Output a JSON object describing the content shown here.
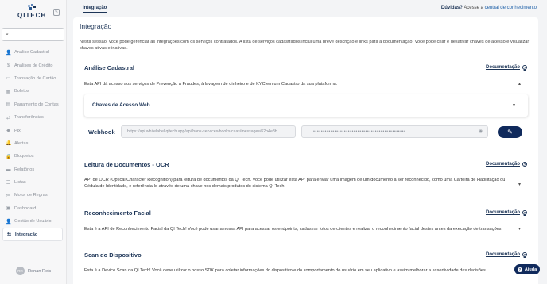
{
  "app": {
    "logo_text": "QITECH",
    "collapse_icon": "<"
  },
  "search": {
    "placeholder": ""
  },
  "sidebar": {
    "items": [
      {
        "label": "Análise Cadastral",
        "icon": "person-icon",
        "glyph": "👤"
      },
      {
        "label": "Análises de Crédito",
        "icon": "dollar-icon",
        "glyph": "$"
      },
      {
        "label": "Transação de Cartão",
        "icon": "card-icon",
        "glyph": "▭"
      },
      {
        "label": "Boletos",
        "icon": "barcode-icon",
        "glyph": "▦"
      },
      {
        "label": "Pagamento de Contas",
        "icon": "receipt-icon",
        "glyph": "▤"
      },
      {
        "label": "Transferências",
        "icon": "transfer-icon",
        "glyph": "⇄"
      },
      {
        "label": "Pix",
        "icon": "pix-icon",
        "glyph": "◆"
      },
      {
        "label": "Alertas",
        "icon": "bell-icon",
        "glyph": "🔔"
      },
      {
        "label": "Bloqueios",
        "icon": "lock-icon",
        "glyph": "🔒"
      },
      {
        "label": "Relatórios",
        "icon": "file-icon",
        "glyph": "▬"
      },
      {
        "label": "Listas",
        "icon": "list-icon",
        "glyph": "☰"
      },
      {
        "label": "Motor de Regras",
        "icon": "rules-icon",
        "glyph": "≔"
      },
      {
        "label": "Dashboard",
        "icon": "dashboard-icon",
        "glyph": "▣"
      },
      {
        "label": "Gestão de Usuário",
        "icon": "user-admin-icon",
        "glyph": "👤"
      },
      {
        "label": "Integração",
        "icon": "link-icon",
        "glyph": "⇆",
        "active": true
      }
    ]
  },
  "user": {
    "initials": "RR",
    "name": "Renan Reis"
  },
  "topbar": {
    "tab": "Integração",
    "help_question": "Dúvidas?",
    "help_text": "Acesse a",
    "help_link": "central de conhecimento"
  },
  "page": {
    "title": "Integração",
    "intro": "Nesta sessão, você pode gerenciar as integrações com os serviços contratados. A lista de serviços cadastrados inclui uma breve descrição e links para a documentação. Você pode criar e desativar chaves de acesso e visualizar chaves ativas e inativas."
  },
  "sections": {
    "doc_label": "Documentação",
    "analise": {
      "title": "Análise Cadastral",
      "desc": "Esta API dá acesso aos serviços de Prevenção a Fraudes, à lavagem de dinheiro e de KYC em um Cadastro da sua plataforma.",
      "keys_title": "Chaves de Acesso Web",
      "webhook_label": "Webhook",
      "webhook_url": "https://api.whitelabel.qitech.app/api/bank-services/hooks/caas/messages/62b4e8b",
      "webhook_key": "••••••••••••••••••••••••••••••••••••••••••••••••"
    },
    "ocr": {
      "title": "Leitura de Documentos - OCR",
      "desc": "API de OCR (Optical Character Recognition) para leitura de documentos da QI Tech. Você pode utilizar esta API para enviar uma imagem de um documento a ser reconhecido, como uma Carteira de Habilitação ou Cédula de Identidade, e referência-lo através de uma chave nos demais produtos do sistema QI Tech."
    },
    "facial": {
      "title": "Reconhecimento Facial",
      "desc": "Esta é a API de Reconhecimento Facial da QI Tech! Você pode usar a nossa API para acessar os endpoints, cadastrar fotos de clientes e realizar o reconhecimento facial destes antes da execução de transações."
    },
    "device": {
      "title": "Scan do Dispositivo",
      "desc": "Esta é a Device Scan da QI Tech! Você deve utilizar o nosso SDK para coletar informações do dispositivo e do comportamento do usuário em seu aplicativo e assim melhorar a assertividade das decisões."
    }
  },
  "help_button": {
    "label": "Ajuda"
  },
  "colors": {
    "brand": "#1d3557",
    "button": "#102a5c"
  }
}
